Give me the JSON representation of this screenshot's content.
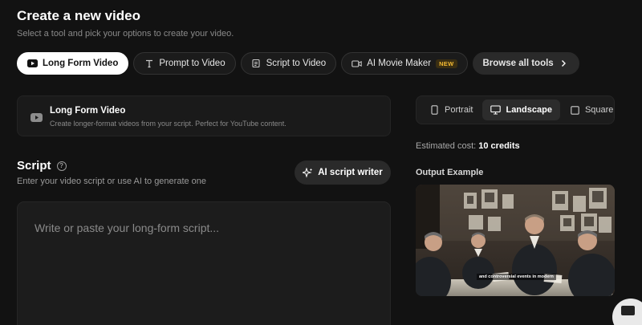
{
  "header": {
    "title": "Create a new video",
    "subtitle": "Select a tool and pick your options to create your video."
  },
  "tools": [
    {
      "label": "Long Form Video",
      "icon": "youtube-icon",
      "active": true
    },
    {
      "label": "Prompt to Video",
      "icon": "text-icon",
      "active": false
    },
    {
      "label": "Script to Video",
      "icon": "scroll-icon",
      "active": false
    },
    {
      "label": "AI Movie Maker",
      "icon": "video-camera-icon",
      "active": false,
      "badge": "NEW"
    },
    {
      "label": "Browse all tools",
      "icon": "chevron-right-icon",
      "active": false
    }
  ],
  "long_form_card": {
    "title": "Long Form Video",
    "description": "Create longer-format videos from your script. Perfect for YouTube content."
  },
  "script": {
    "label": "Script",
    "description": "Enter your video script or use AI to generate one",
    "ai_writer_label": "AI script writer",
    "placeholder": "Write or paste your long-form script..."
  },
  "orientation": {
    "options": [
      {
        "label": "Portrait",
        "icon": "portrait-icon",
        "active": false
      },
      {
        "label": "Landscape",
        "icon": "monitor-icon",
        "active": true
      },
      {
        "label": "Square",
        "icon": "square-icon",
        "active": false
      }
    ]
  },
  "cost": {
    "label": "Estimated cost:",
    "value": "10 credits"
  },
  "output_example": {
    "label": "Output Example",
    "caption": "and controversial events in modern"
  },
  "colors": {
    "background": "#121212",
    "panel": "#1a1a1a",
    "badge_text": "#f2b933"
  }
}
